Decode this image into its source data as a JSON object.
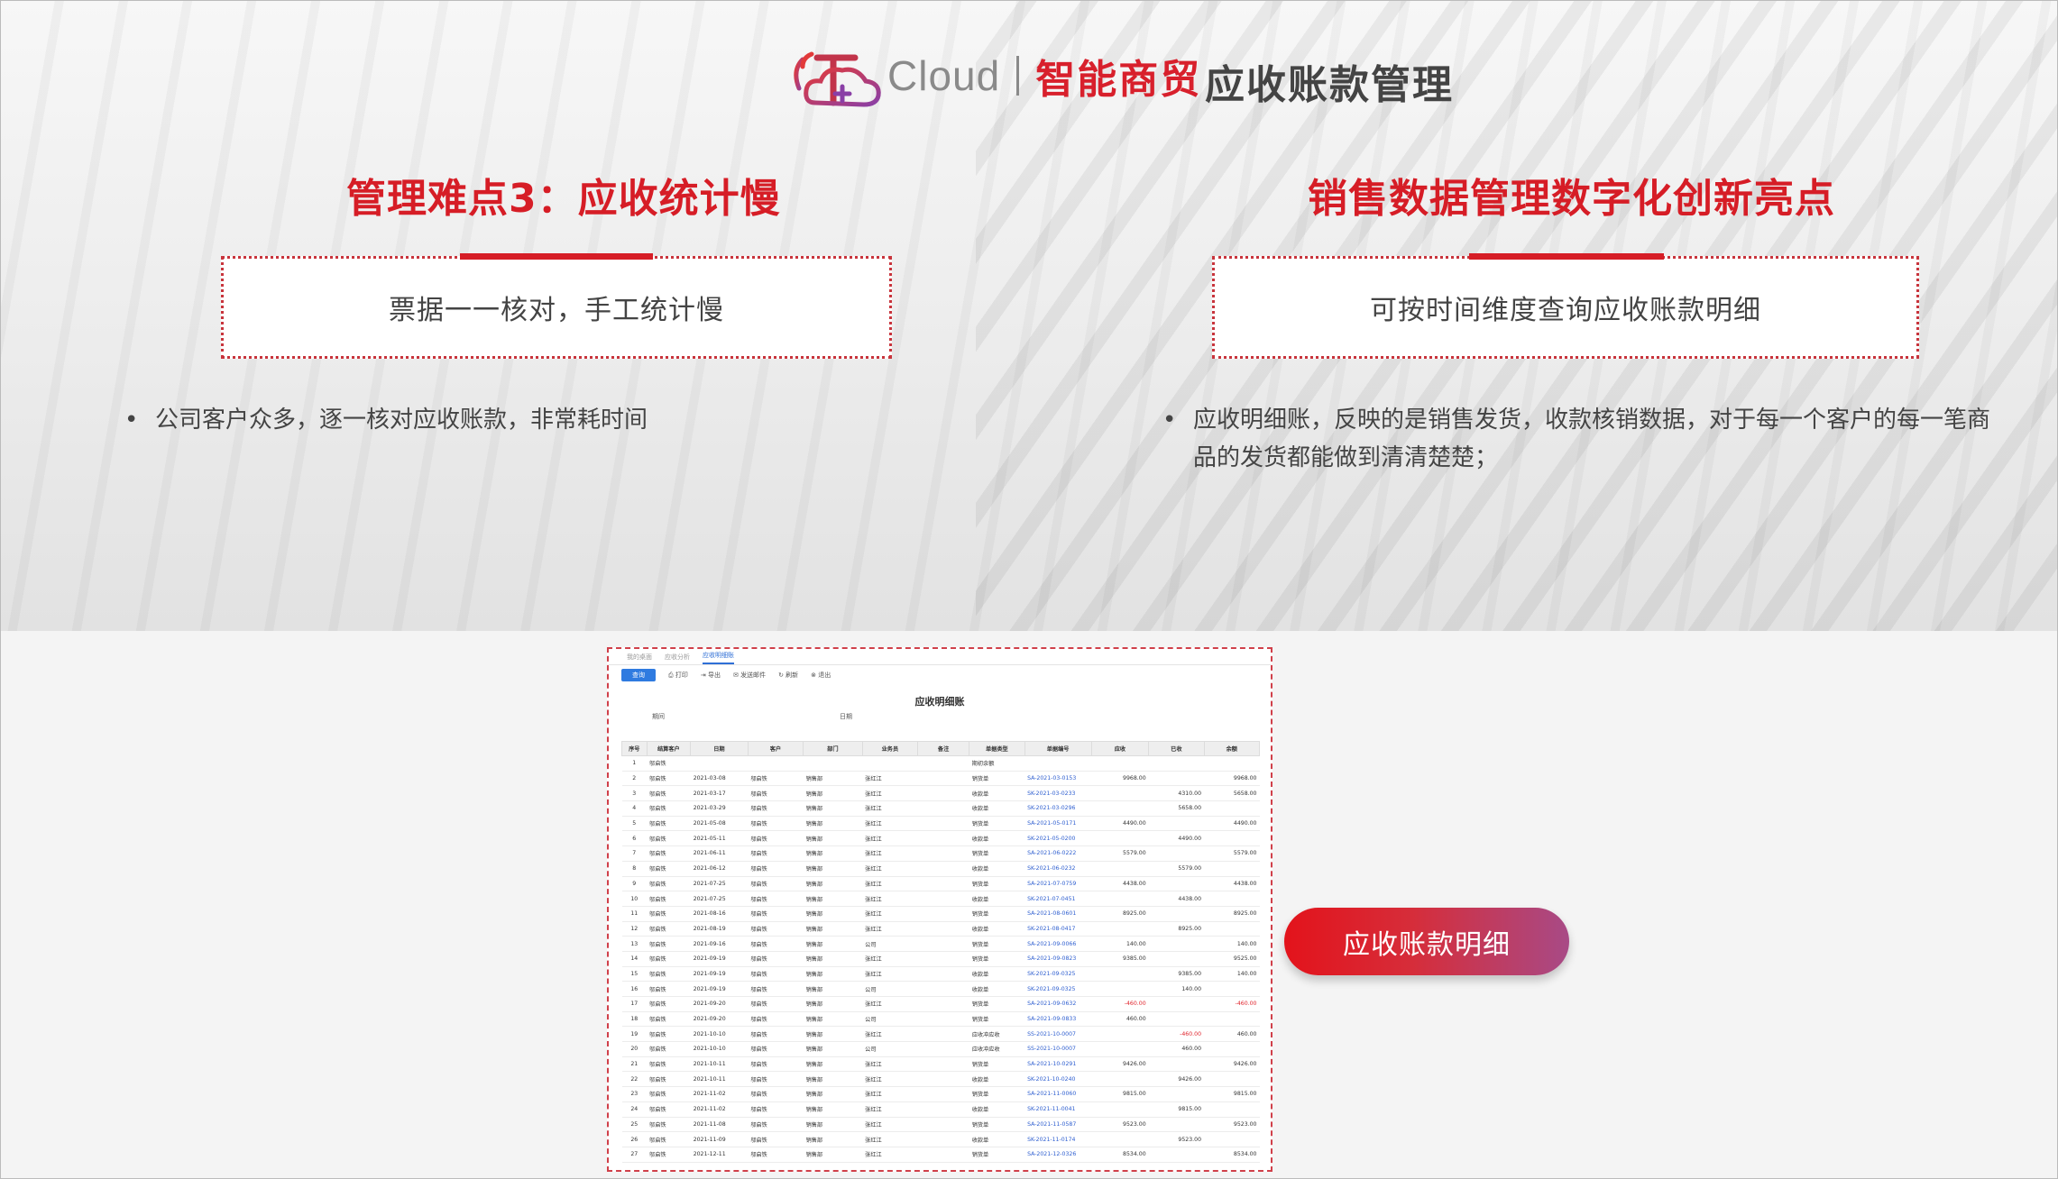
{
  "header": {
    "brand_cloud": "Cloud",
    "brand_name": "智能商贸",
    "page_title": "应收账款管理",
    "colors": {
      "accent": "#d61d26",
      "logo_red": "#e23a3a",
      "logo_purple": "#8a3fa6"
    }
  },
  "left": {
    "title": "管理难点3：应收统计慢",
    "box_text": "票据一一核对，手工统计慢",
    "bullets": [
      "公司客户众多，逐一核对应收账款，非常耗时间"
    ]
  },
  "right": {
    "title": "销售数据管理数字化创新亮点",
    "box_text": "可按时间维度查询应收账款明细",
    "bullet_line1": "应收明细账，反映的是销售发货，收款核销数据，对于每一个客户的每一笔商",
    "bullet_line2": "品的发货都能做到清清楚楚；"
  },
  "screenshot": {
    "tabs": [
      "我的桌面",
      "应收分析",
      "应收明细账"
    ],
    "active_tab_index": 2,
    "toolbar": [
      "查询",
      "打印",
      "导出",
      "发送邮件",
      "刷新",
      "退出"
    ],
    "report_title": "应收明细账",
    "meta_period": "期间",
    "meta_date": "日期",
    "columns": [
      "序号",
      "结算客户",
      "日期",
      "客户",
      "部门",
      "业务员",
      "备注",
      "单据类型",
      "单据编号",
      "应收",
      "已收",
      "余额"
    ],
    "rows": [
      [
        "1",
        "邬启铁",
        "",
        "",
        "",
        "",
        "",
        "期初余额",
        "",
        "",
        "",
        ""
      ],
      [
        "2",
        "邬启铁",
        "2021-03-08",
        "邬启铁",
        "销售部",
        "张红江",
        "",
        "销货单",
        "SA-2021-03-0153",
        "9968.00",
        "",
        "9968.00"
      ],
      [
        "3",
        "邬启铁",
        "2021-03-17",
        "邬启铁",
        "销售部",
        "张红江",
        "",
        "收款单",
        "SK-2021-03-0233",
        "",
        "4310.00",
        "5658.00"
      ],
      [
        "4",
        "邬启铁",
        "2021-03-29",
        "邬启铁",
        "销售部",
        "张红江",
        "",
        "收款单",
        "SK-2021-03-0296",
        "",
        "5658.00",
        ""
      ],
      [
        "5",
        "邬启铁",
        "2021-05-08",
        "邬启铁",
        "销售部",
        "张红江",
        "",
        "销货单",
        "SA-2021-05-0171",
        "4490.00",
        "",
        "4490.00"
      ],
      [
        "6",
        "邬启铁",
        "2021-05-11",
        "邬启铁",
        "销售部",
        "张红江",
        "",
        "收款单",
        "SK-2021-05-0200",
        "",
        "4490.00",
        ""
      ],
      [
        "7",
        "邬启铁",
        "2021-06-11",
        "邬启铁",
        "销售部",
        "张红江",
        "",
        "销货单",
        "SA-2021-06-0222",
        "5579.00",
        "",
        "5579.00"
      ],
      [
        "8",
        "邬启铁",
        "2021-06-12",
        "邬启铁",
        "销售部",
        "张红江",
        "",
        "收款单",
        "SK-2021-06-0232",
        "",
        "5579.00",
        ""
      ],
      [
        "9",
        "邬启铁",
        "2021-07-25",
        "邬启铁",
        "销售部",
        "张红江",
        "",
        "销货单",
        "SA-2021-07-0759",
        "4438.00",
        "",
        "4438.00"
      ],
      [
        "10",
        "邬启铁",
        "2021-07-25",
        "邬启铁",
        "销售部",
        "张红江",
        "",
        "收款单",
        "SK-2021-07-0451",
        "",
        "4438.00",
        ""
      ],
      [
        "11",
        "邬启铁",
        "2021-08-16",
        "邬启铁",
        "销售部",
        "张红江",
        "",
        "销货单",
        "SA-2021-08-0601",
        "8925.00",
        "",
        "8925.00"
      ],
      [
        "12",
        "邬启铁",
        "2021-08-19",
        "邬启铁",
        "销售部",
        "张红江",
        "",
        "收款单",
        "SK-2021-08-0417",
        "",
        "8925.00",
        ""
      ],
      [
        "13",
        "邬启铁",
        "2021-09-16",
        "邬启铁",
        "销售部",
        "公司",
        "",
        "销货单",
        "SA-2021-09-0066",
        "140.00",
        "",
        "140.00"
      ],
      [
        "14",
        "邬启铁",
        "2021-09-19",
        "邬启铁",
        "销售部",
        "张红江",
        "",
        "销货单",
        "SA-2021-09-0823",
        "9385.00",
        "",
        "9525.00"
      ],
      [
        "15",
        "邬启铁",
        "2021-09-19",
        "邬启铁",
        "销售部",
        "张红江",
        "",
        "收款单",
        "SK-2021-09-0325",
        "",
        "9385.00",
        "140.00"
      ],
      [
        "16",
        "邬启铁",
        "2021-09-19",
        "邬启铁",
        "销售部",
        "公司",
        "",
        "收款单",
        "SK-2021-09-0325",
        "",
        "140.00",
        ""
      ],
      [
        "17",
        "邬启铁",
        "2021-09-20",
        "邬启铁",
        "销售部",
        "张红江",
        "",
        "销货单",
        "SA-2021-09-0632",
        "-460.00",
        "",
        "-460.00"
      ],
      [
        "18",
        "邬启铁",
        "2021-09-20",
        "邬启铁",
        "销售部",
        "公司",
        "",
        "销货单",
        "SA-2021-09-0833",
        "460.00",
        "",
        ""
      ],
      [
        "19",
        "邬启铁",
        "2021-10-10",
        "邬启铁",
        "销售部",
        "张红江",
        "",
        "应收冲应收",
        "SS-2021-10-0007",
        "",
        "-460.00",
        "460.00"
      ],
      [
        "20",
        "邬启铁",
        "2021-10-10",
        "邬启铁",
        "销售部",
        "公司",
        "",
        "应收冲应收",
        "SS-2021-10-0007",
        "",
        "460.00",
        ""
      ],
      [
        "21",
        "邬启铁",
        "2021-10-11",
        "邬启铁",
        "销售部",
        "张红江",
        "",
        "销货单",
        "SA-2021-10-0291",
        "9426.00",
        "",
        "9426.00"
      ],
      [
        "22",
        "邬启铁",
        "2021-10-11",
        "邬启铁",
        "销售部",
        "张红江",
        "",
        "收款单",
        "SK-2021-10-0240",
        "",
        "9426.00",
        ""
      ],
      [
        "23",
        "邬启铁",
        "2021-11-02",
        "邬启铁",
        "销售部",
        "张红江",
        "",
        "销货单",
        "SA-2021-11-0060",
        "9815.00",
        "",
        "9815.00"
      ],
      [
        "24",
        "邬启铁",
        "2021-11-02",
        "邬启铁",
        "销售部",
        "张红江",
        "",
        "收款单",
        "SK-2021-11-0041",
        "",
        "9815.00",
        ""
      ],
      [
        "25",
        "邬启铁",
        "2021-11-08",
        "邬启铁",
        "销售部",
        "张红江",
        "",
        "销货单",
        "SA-2021-11-0587",
        "9523.00",
        "",
        "9523.00"
      ],
      [
        "26",
        "邬启铁",
        "2021-11-09",
        "邬启铁",
        "销售部",
        "张红江",
        "",
        "收款单",
        "SK-2021-11-0174",
        "",
        "9523.00",
        ""
      ],
      [
        "27",
        "邬启铁",
        "2021-12-11",
        "邬启铁",
        "销售部",
        "张红江",
        "",
        "销货单",
        "SA-2021-12-0326",
        "8534.00",
        "",
        "8534.00"
      ]
    ]
  },
  "cta": {
    "label": "应收账款明细"
  }
}
